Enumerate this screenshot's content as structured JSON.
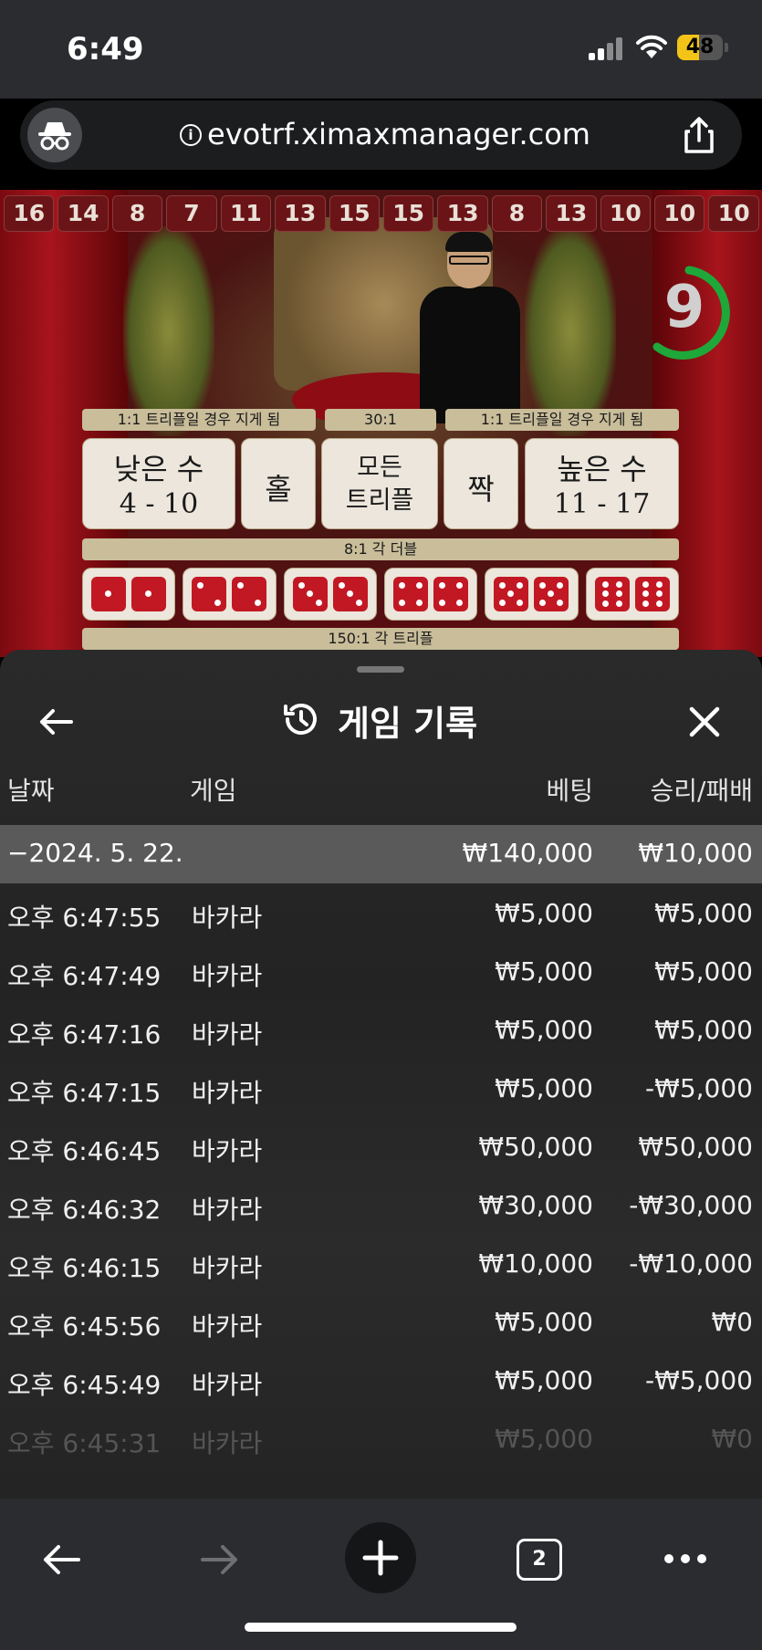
{
  "status_bar": {
    "time": "6:49",
    "battery": "48"
  },
  "url_bar": {
    "url": "evotrf.ximaxmanager.com"
  },
  "game": {
    "history": [
      "16",
      "14",
      "8",
      "7",
      "11",
      "13",
      "15",
      "15",
      "13",
      "8",
      "13",
      "10",
      "10",
      "10"
    ],
    "timer": "9",
    "labels": {
      "left_triple": "1:1 트리플일 경우 지게 됨",
      "center_odds": "30:1",
      "right_triple": "1:1 트리플일 경우 지게 됨",
      "double": "8:1 각 더블",
      "triple": "150:1 각 트리플"
    },
    "bets": {
      "small": {
        "title": "낮은 수",
        "range": "4 - 10"
      },
      "odd": "홀",
      "any_triple": {
        "line1": "모든",
        "line2": "트리플"
      },
      "even": "짝",
      "big": {
        "title": "높은 수",
        "range": "11 - 17"
      }
    }
  },
  "panel": {
    "title": "게임 기록",
    "columns": {
      "date": "날짜",
      "game": "게임",
      "bet": "베팅",
      "winloss": "승리/패배"
    },
    "date_group": {
      "date": "−2024. 5. 22.",
      "bet_total": "₩140,000",
      "winloss_total": "₩10,000"
    },
    "rows": [
      {
        "time": "오후 6:47:55",
        "game": "바카라",
        "bet": "₩5,000",
        "winloss": "₩5,000"
      },
      {
        "time": "오후 6:47:49",
        "game": "바카라",
        "bet": "₩5,000",
        "winloss": "₩5,000"
      },
      {
        "time": "오후 6:47:16",
        "game": "바카라",
        "bet": "₩5,000",
        "winloss": "₩5,000"
      },
      {
        "time": "오후 6:47:15",
        "game": "바카라",
        "bet": "₩5,000",
        "winloss": "-₩5,000"
      },
      {
        "time": "오후 6:46:45",
        "game": "바카라",
        "bet": "₩50,000",
        "winloss": "₩50,000"
      },
      {
        "time": "오후 6:46:32",
        "game": "바카라",
        "bet": "₩30,000",
        "winloss": "-₩30,000"
      },
      {
        "time": "오후 6:46:15",
        "game": "바카라",
        "bet": "₩10,000",
        "winloss": "-₩10,000"
      },
      {
        "time": "오후 6:45:56",
        "game": "바카라",
        "bet": "₩5,000",
        "winloss": "₩0"
      },
      {
        "time": "오후 6:45:49",
        "game": "바카라",
        "bet": "₩5,000",
        "winloss": "-₩5,000"
      },
      {
        "time": "오후 6:45:31",
        "game": "바카라",
        "bet": "₩5,000",
        "winloss": "₩0"
      }
    ]
  },
  "toolbar": {
    "tab_count": "2"
  }
}
